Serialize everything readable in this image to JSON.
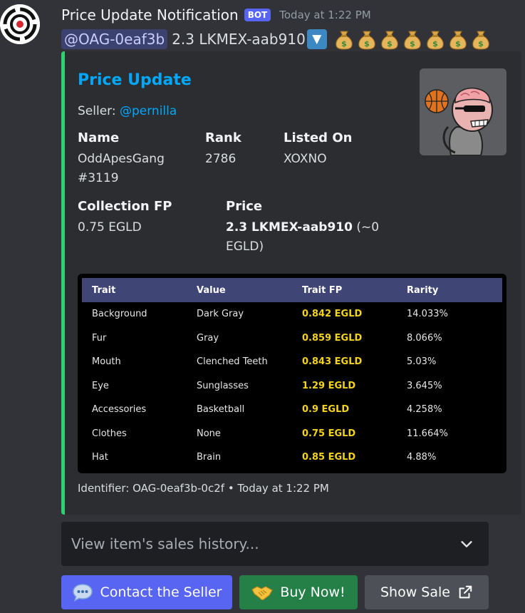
{
  "message": {
    "author": "Price Update Notification",
    "bot_tag": "BOT",
    "timestamp": "Today at 1:22 PM",
    "mention": "@OAG-0eaf3b",
    "text": "2.3 LKMEX-aab910",
    "down_arrow_icon": "arrow-down-small-icon",
    "moneybag_count": 7
  },
  "embed": {
    "accent_color": "#2fd072",
    "title": "Price Update",
    "seller_label": "Seller:",
    "seller_handle": "@pernilla",
    "fields": {
      "name_label": "Name",
      "name_value_line1": "OddApesGang",
      "name_value_line2": "#3119",
      "rank_label": "Rank",
      "rank_value": "2786",
      "listed_label": "Listed On",
      "listed_value": "XOXNO",
      "fp_label": "Collection FP",
      "fp_value": "0.75 EGLD",
      "price_label": "Price",
      "price_bold": "2.3 LKMEX-aab910",
      "price_rest_line1": "(~0",
      "price_rest_line2": "EGLD)"
    },
    "trait_table": {
      "headers": [
        "Trait",
        "Value",
        "Trait FP",
        "Rarity"
      ],
      "rows": [
        [
          "Background",
          "Dark Gray",
          "0.842 EGLD",
          "14.033%"
        ],
        [
          "Fur",
          "Gray",
          "0.859 EGLD",
          "8.066%"
        ],
        [
          "Mouth",
          "Clenched Teeth",
          "0.843 EGLD",
          "5.03%"
        ],
        [
          "Eye",
          "Sunglasses",
          "1.29 EGLD",
          "3.645%"
        ],
        [
          "Accessories",
          "Basketball",
          "0.9 EGLD",
          "4.258%"
        ],
        [
          "Clothes",
          "None",
          "0.75 EGLD",
          "11.664%"
        ],
        [
          "Hat",
          "Brain",
          "0.85 EGLD",
          "4.88%"
        ]
      ]
    },
    "footer": "Identifier: OAG-0eaf3b-0c2f • Today at 1:22 PM"
  },
  "components": {
    "select_placeholder": "View item's sales history...",
    "contact_button": "Contact the Seller",
    "buy_button": "Buy Now!",
    "show_sale_button": "Show Sale"
  },
  "colors": {
    "primary": "#5865f2",
    "success": "#248046",
    "secondary": "#4e5058",
    "link": "#00a8fc",
    "trait_fp": "#f3d31b"
  }
}
